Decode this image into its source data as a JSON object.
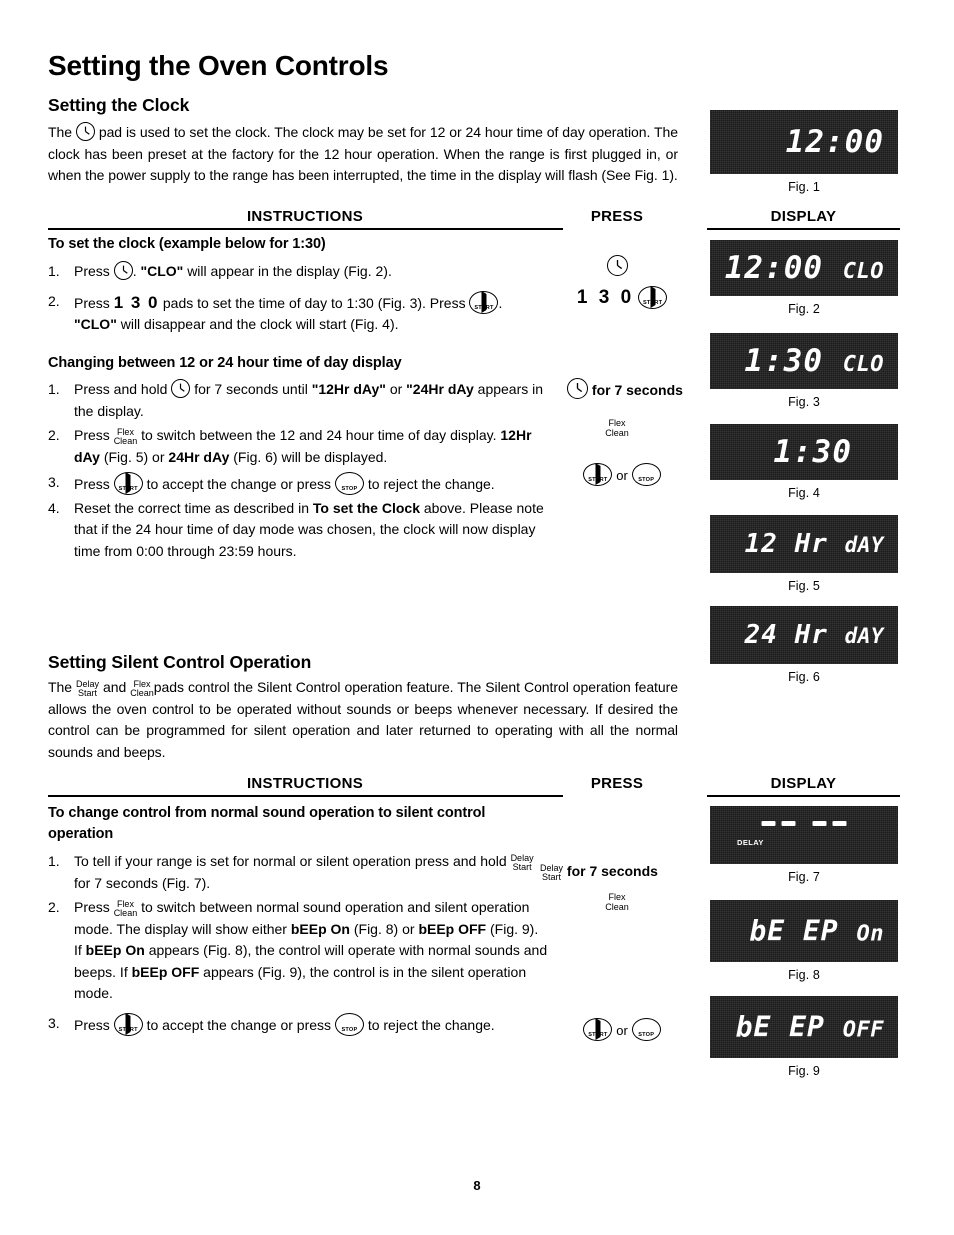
{
  "page": {
    "title": "Setting the Oven Controls",
    "page_number": "8"
  },
  "clock_section": {
    "heading": "Setting the Clock",
    "intro_parts": {
      "p1": "The",
      "p2": "pad is used to set the clock. The clock may be set for 12 or 24 hour time of day operation. The clock has been preset at the factory for the 12 hour operation.  When the range is first plugged in, or when the power supply to the range has been interrupted, the time in the display will flash (See Fig. 1)."
    },
    "columns": {
      "instructions": "INSTRUCTIONS",
      "press": "PRESS",
      "display": "DISPLAY"
    },
    "set_clock": {
      "heading": "To set the clock (example below for 1:30)",
      "step1": {
        "num": "1.",
        "a": "Press",
        "b": ".",
        "c": "\"CLO\"",
        "d": "will appear in the display (Fig. 2)."
      },
      "step2": {
        "num": "2.",
        "a": "Press",
        "digits": "1 3 0",
        "b": "pads to set the time of day to 1:30 (Fig. 3). Press",
        "c": ".",
        "d": "\"CLO\"",
        "e": "will disappear and the clock will start (Fig. 4)."
      }
    },
    "changing": {
      "heading": "Changing between 12 or 24 hour time of day display",
      "step1": {
        "num": "1.",
        "a": "Press and hold",
        "b": "for 7 seconds until",
        "c": "\"12Hr dAy\"",
        "d": "or",
        "e": "\"24Hr dAy",
        "f": "appears in the display."
      },
      "step2": {
        "num": "2.",
        "a": "Press",
        "pad_line1": "Flex",
        "pad_line2": "Clean",
        "b": "to switch between the 12 and 24 hour time of day display.",
        "c": "12Hr dAy",
        "d": "(Fig. 5) or",
        "e": "24Hr dAy",
        "f": "(Fig. 6) will be displayed."
      },
      "step3": {
        "num": "3.",
        "a": "Press",
        "b": "to accept the change or press",
        "c": "to reject the change."
      },
      "step4": {
        "num": "4.",
        "a": "Reset the correct time as described in",
        "b": "To set the Clock",
        "c": "above. Please note that if the 24 hour time of day mode was chosen, the clock will now display time from 0:00 through 23:59 hours."
      }
    },
    "press_cells": {
      "clock_only": "",
      "digits_start": "1 3 0",
      "hold7": "for 7 seconds",
      "flex_line1": "Flex",
      "flex_line2": "Clean",
      "or": "or"
    }
  },
  "silent_section": {
    "heading": "Setting Silent Control Operation",
    "intro": {
      "a": "The",
      "pad1_line1": "Delay",
      "pad1_line2": "Start",
      "b": "and",
      "pad2_line1": "Flex",
      "pad2_line2": "Clean",
      "c": "pads control the Silent Control operation feature. The Silent Control operation feature allows the oven control to be operated without sounds or beeps whenever necessary. If desired the control can be programmed for silent operation and later returned to operating with all the normal sounds and beeps."
    },
    "columns": {
      "instructions": "INSTRUCTIONS",
      "press": "PRESS",
      "display": "DISPLAY"
    },
    "change_control": {
      "heading": "To change control from normal sound operation to silent control operation",
      "step1": {
        "num": "1.",
        "a": "To tell if your range is set for normal or silent operation press and hold",
        "pad_line1": "Delay",
        "pad_line2": "Start",
        "b": "for 7 seconds (Fig. 7)."
      },
      "step2": {
        "num": "2.",
        "a": "Press",
        "pad_line1": "Flex",
        "pad_line2": "Clean",
        "b": "to switch between normal sound operation and silent operation mode. The display will show either",
        "c": "bEEp On",
        "d": "(Fig. 8) or",
        "e": "bEEp OFF",
        "f": "(Fig. 9).",
        "g": "If",
        "h": "bEEp On",
        "i": "appears (Fig. 8), the control will operate with normal sounds and beeps. If",
        "j": "bEEp OFF",
        "k": "appears (Fig. 9), the control is in the silent operation mode."
      },
      "step3": {
        "num": "3.",
        "a": "Press",
        "b": "to accept the change or press",
        "c": "to reject the change."
      }
    },
    "press_cells": {
      "delay_line1": "Delay",
      "delay_line2": "Start",
      "hold7": "for 7 seconds",
      "flex_line1": "Flex",
      "flex_line2": "Clean",
      "or": "or"
    }
  },
  "pads": {
    "start_label": "START",
    "stop_label": "STOP"
  },
  "figures": [
    {
      "id": "fig1",
      "caption": "Fig. 1",
      "main": "12:00",
      "suffix": "",
      "annunciator": "",
      "dashes": false
    },
    {
      "id": "fig2",
      "caption": "Fig. 2",
      "main": "12:00",
      "suffix": "CLO",
      "annunciator": "",
      "dashes": false
    },
    {
      "id": "fig3",
      "caption": "Fig. 3",
      "main": "1:30",
      "suffix": "CLO",
      "annunciator": "",
      "dashes": false
    },
    {
      "id": "fig4",
      "caption": "Fig. 4",
      "main": "1:30",
      "suffix": "",
      "annunciator": "",
      "dashes": false
    },
    {
      "id": "fig5",
      "caption": "Fig. 5",
      "main": "12 Hr",
      "suffix": "dAY",
      "annunciator": "",
      "dashes": false
    },
    {
      "id": "fig6",
      "caption": "Fig. 6",
      "main": "24 Hr",
      "suffix": "dAY",
      "annunciator": "",
      "dashes": false
    },
    {
      "id": "fig7",
      "caption": "Fig. 7",
      "main": "",
      "suffix": "",
      "annunciator": "DELAY",
      "dashes": true
    },
    {
      "id": "fig8",
      "caption": "Fig. 8",
      "main": "bE EP",
      "suffix": "On",
      "annunciator": "",
      "dashes": false
    },
    {
      "id": "fig9",
      "caption": "Fig. 9",
      "main": "bE EP",
      "suffix": "OFF",
      "annunciator": "",
      "dashes": false
    }
  ]
}
